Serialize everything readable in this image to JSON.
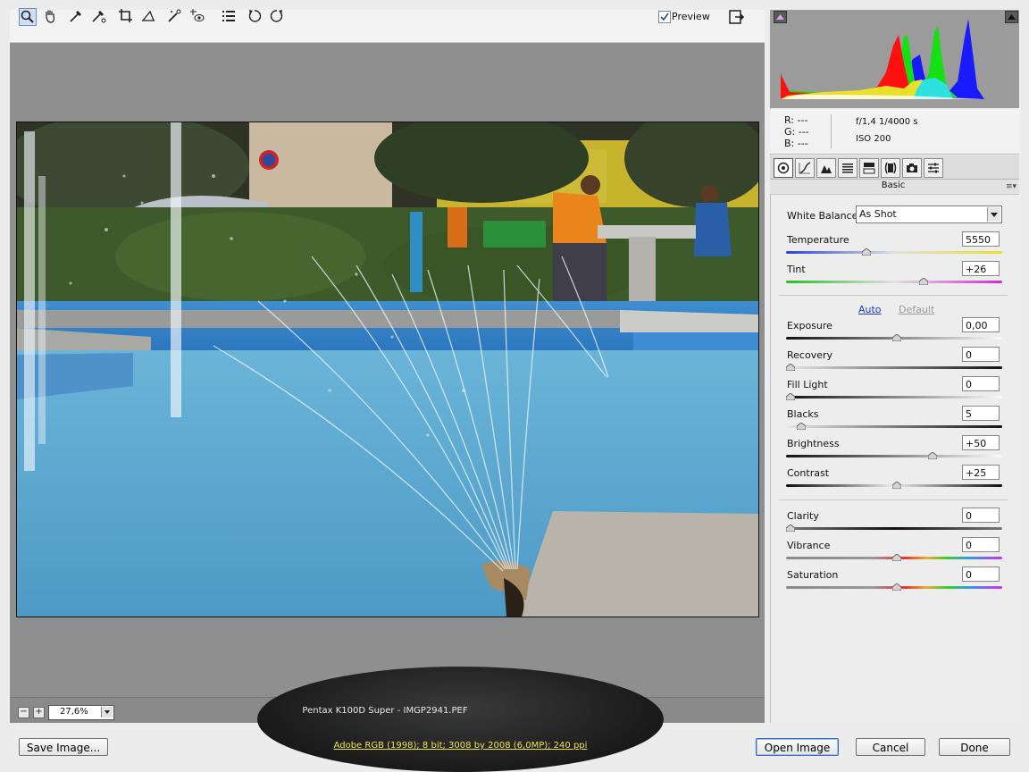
{
  "toolbar": {
    "tools": [
      "zoom-icon",
      "hand-icon",
      "white-balance-icon",
      "color-sampler-icon",
      "crop-icon",
      "straighten-icon",
      "retouch-icon",
      "red-eye-icon",
      "preferences-icon",
      "rotate-left-icon",
      "rotate-right-icon"
    ],
    "preview_label": "Preview",
    "preview_checked": true
  },
  "status": {
    "zoom_minus": "−",
    "zoom_plus": "+",
    "zoom_value": "27,6%",
    "camera_file": "Pentax K100D Super  -  IMGP2941.PEF",
    "workflow": "Adobe RGB (1998); 8 bit; 3008 by 2008 (6,0MP); 240 ppi"
  },
  "readout": {
    "r": "R:  ---",
    "g": "G:  ---",
    "b": "B:  ---",
    "exposure": "f/1,4    1/4000 s",
    "iso": "ISO 200"
  },
  "panel": {
    "tabs": [
      "basic-icon",
      "tone-curve-icon",
      "detail-icon",
      "hsl-icon",
      "split-toning-icon",
      "lens-corrections-icon",
      "camera-calibration-icon",
      "presets-icon"
    ],
    "section_title": "Basic",
    "white_balance_label": "White Balance:",
    "white_balance_value": "As Shot",
    "auto_label": "Auto",
    "default_label": "Default",
    "sliders": [
      {
        "name": "temperature",
        "label": "Temperature",
        "value": "5550",
        "position": 0.36
      },
      {
        "name": "tint",
        "label": "Tint",
        "value": "+26",
        "position": 0.63
      },
      {
        "name": "exposure",
        "label": "Exposure",
        "value": "0,00",
        "position": 0.5
      },
      {
        "name": "recovery",
        "label": "Recovery",
        "value": "0",
        "position": 0.0
      },
      {
        "name": "fill-light",
        "label": "Fill Light",
        "value": "0",
        "position": 0.0
      },
      {
        "name": "blacks",
        "label": "Blacks",
        "value": "5",
        "position": 0.05
      },
      {
        "name": "brightness",
        "label": "Brightness",
        "value": "+50",
        "position": 0.67
      },
      {
        "name": "contrast",
        "label": "Contrast",
        "value": "+25",
        "position": 0.5
      },
      {
        "name": "clarity",
        "label": "Clarity",
        "value": "0",
        "position": 0.0
      },
      {
        "name": "vibrance",
        "label": "Vibrance",
        "value": "0",
        "position": 0.5
      },
      {
        "name": "saturation",
        "label": "Saturation",
        "value": "0",
        "position": 0.5
      }
    ]
  },
  "buttons": {
    "save": "Save Image...",
    "open": "Open Image",
    "cancel": "Cancel",
    "done": "Done"
  },
  "colors": {
    "preview_bg": "#8f8f8f",
    "link_blue": "#1a3cc9",
    "workflow_yellow": "#f0e24a"
  }
}
